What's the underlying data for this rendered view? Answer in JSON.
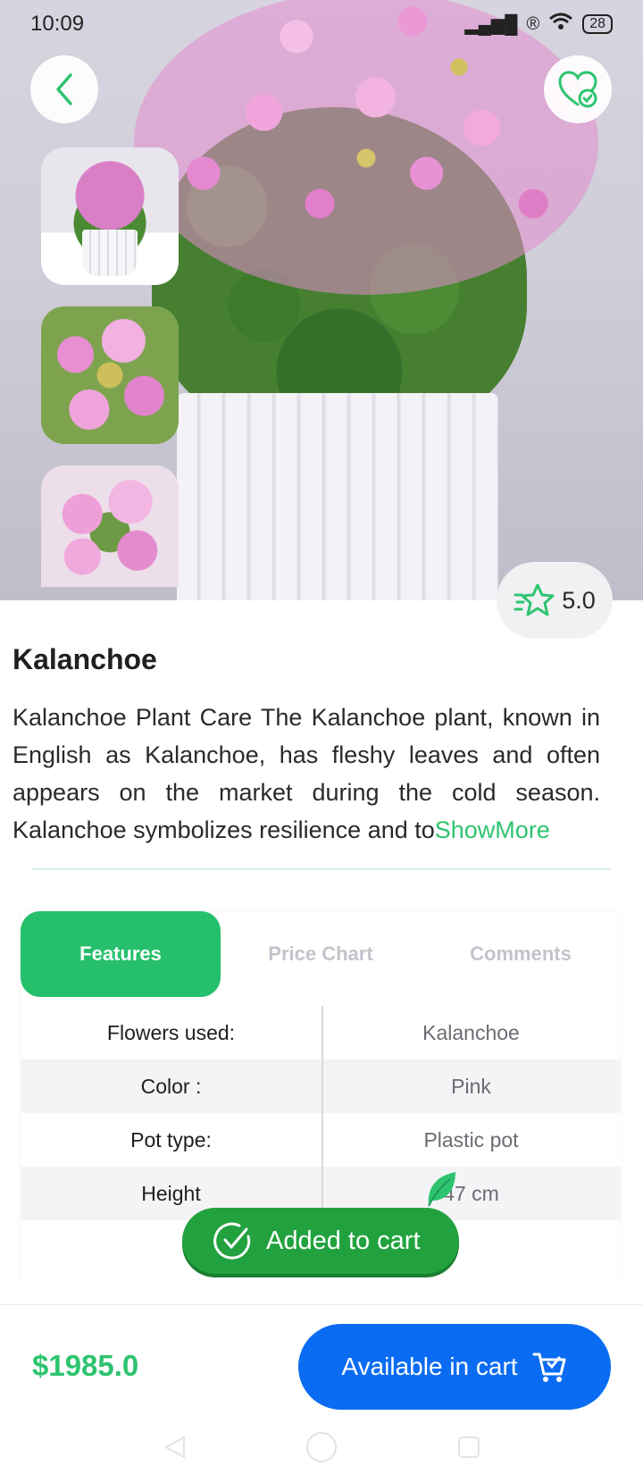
{
  "status_bar": {
    "time": "10:09",
    "battery": "28"
  },
  "gallery": {
    "thumbnails": [
      "kalanchoe-thumb-1",
      "kalanchoe-thumb-2",
      "kalanchoe-thumb-3"
    ]
  },
  "rating": "5.0",
  "product": {
    "title": "Kalanchoe",
    "description": "Kalanchoe Plant Care The Kalanchoe plant, known in English as Kalanchoe, has fleshy leaves and often appears on the market during the cold season. Kalanchoe symbolizes resilience and to",
    "show_more": "ShowMore"
  },
  "tabs": [
    {
      "label": "Features",
      "active": true
    },
    {
      "label": "Price Chart",
      "active": false
    },
    {
      "label": "Comments",
      "active": false
    }
  ],
  "features": [
    {
      "key": "Flowers used:",
      "value": "Kalanchoe"
    },
    {
      "key": "Color :",
      "value": "Pink"
    },
    {
      "key": "Pot type:",
      "value": "Plastic pot"
    },
    {
      "key": "Height",
      "value": "47 cm"
    }
  ],
  "toast": "Added to cart",
  "bottom": {
    "price": "$1985.0",
    "cart_button": "Available in cart"
  },
  "colors": {
    "accent_green": "#26c06c",
    "toast_green": "#22a23e",
    "cart_blue": "#0a6cf2"
  }
}
